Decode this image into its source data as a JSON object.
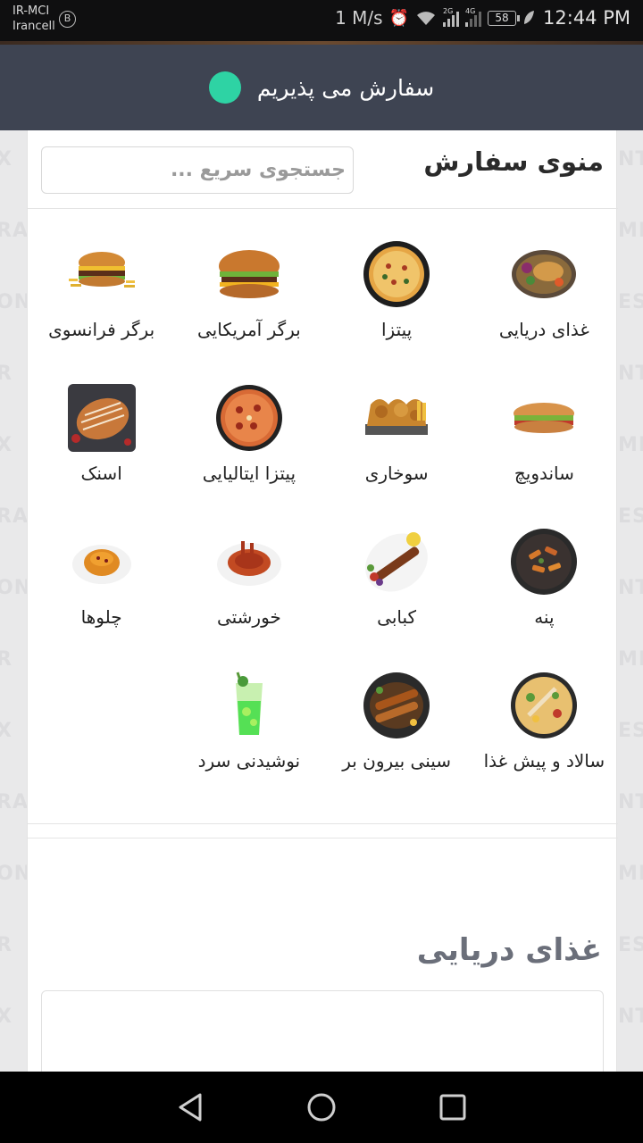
{
  "status_bar": {
    "carrier_line1": "IR-MCI",
    "carrier_line2": "Irancell",
    "badge": "B",
    "speed": "1 M/s",
    "net1": "2G",
    "net2": "4G",
    "battery": "58",
    "time": "12:44 PM"
  },
  "header": {
    "status_text": "سفارش می پذیریم",
    "status_color": "#2ed3a4"
  },
  "watermark": [
    "X",
    "RA",
    "ON",
    "R",
    "X",
    "RA",
    "ON",
    "R",
    "X",
    "RA",
    "ON",
    "R",
    "X"
  ],
  "watermark_right": [
    "NT",
    "MI",
    "ES",
    "NT",
    "MI",
    "ES",
    "NT",
    "MI",
    "ES",
    "NT",
    "MI",
    "ES",
    "NT"
  ],
  "menu": {
    "title": "منوی سفارش",
    "search_placeholder": "جستجوی سریع ..."
  },
  "categories": [
    {
      "label": "غذای دریایی",
      "icon": "seafood-plate-icon"
    },
    {
      "label": "پیتزا",
      "icon": "pizza-icon"
    },
    {
      "label": "برگر آمریکایی",
      "icon": "american-burger-icon"
    },
    {
      "label": "برگر فرانسوی",
      "icon": "french-burger-icon"
    },
    {
      "label": "ساندویچ",
      "icon": "sandwich-icon"
    },
    {
      "label": "سوخاری",
      "icon": "fried-chicken-icon"
    },
    {
      "label": "پیتزا ایتالیایی",
      "icon": "italian-pizza-icon"
    },
    {
      "label": "اسنک",
      "icon": "snack-icon"
    },
    {
      "label": "پنه",
      "icon": "penne-icon"
    },
    {
      "label": "کبابی",
      "icon": "kebab-icon"
    },
    {
      "label": "خورشتی",
      "icon": "stew-icon"
    },
    {
      "label": "چلوها",
      "icon": "rice-dish-icon"
    },
    {
      "label": "سالاد و پیش غذا",
      "icon": "salad-icon"
    },
    {
      "label": "سینی بیرون بر",
      "icon": "takeaway-tray-icon"
    },
    {
      "label": "نوشیدنی سرد",
      "icon": "cold-drink-icon"
    }
  ],
  "section": {
    "title": "غذای دریایی"
  },
  "nav": {
    "back": "back-icon",
    "home": "home-icon",
    "recents": "recents-icon"
  }
}
